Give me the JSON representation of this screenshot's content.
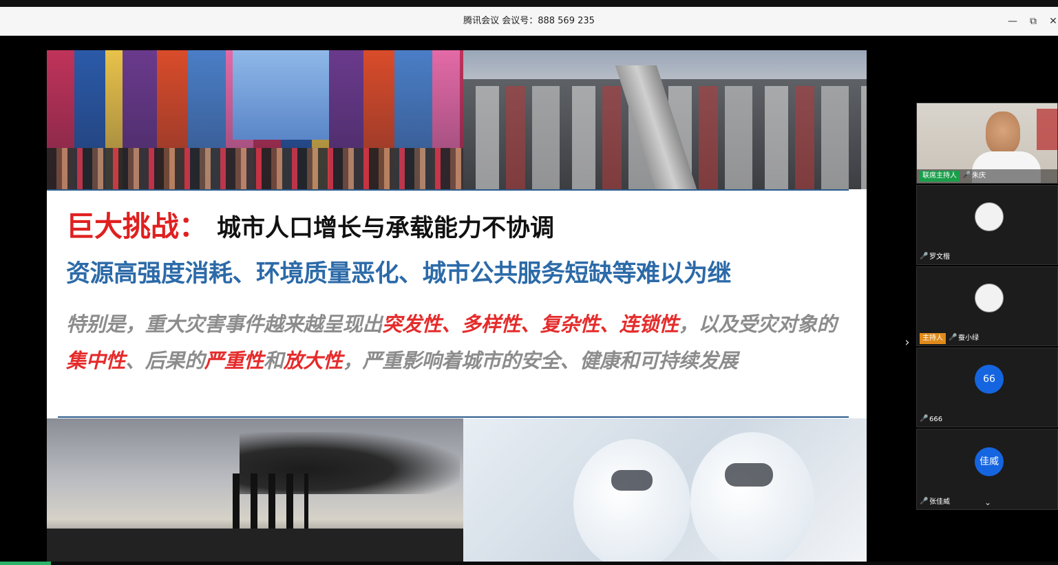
{
  "window": {
    "title": "腾讯会议 会议号：888 569 235",
    "minimize_icon": "—",
    "restore_icon": "⧉",
    "close_icon": "✕"
  },
  "slide": {
    "headline_red": "巨大挑战：",
    "headline_black": "城市人口增长与承载能力不协调",
    "subline": "资源高强度消耗、环境质量恶化、城市公共服务短缺等难以为继",
    "para_parts": {
      "p1": "特别是，重大灾害事件越来越呈现出",
      "h1": "突发性",
      "s1": "、",
      "h2": "多样性",
      "s2": "、",
      "h3": "复杂性",
      "s3": "、",
      "h4": "连锁性",
      "p2": "，以及受灾对象的",
      "h5": "集中性",
      "p3": "、后果的",
      "h6": "严重性",
      "p4": "和",
      "h7": "放大性",
      "p5": "，严重影响着城市的安全、健康和可持续发展"
    }
  },
  "panel": {
    "expand_icon": "›",
    "collapse_icon": "⌄",
    "participants": [
      {
        "role": "联席主持人",
        "name": "朱庆",
        "mic_icon": "🎤"
      },
      {
        "role": "",
        "name": "罗文楷",
        "avatar_text": "",
        "mic_icon": "🎤"
      },
      {
        "role": "主持人",
        "name": "蚕小绿",
        "avatar_text": "",
        "mic_icon": "🎤"
      },
      {
        "role": "",
        "name": "666",
        "avatar_text": "66",
        "mic_icon": "🎤"
      },
      {
        "role": "",
        "name": "张佳威",
        "avatar_text": "佳威",
        "mic_icon": "🎤"
      }
    ]
  },
  "colors": {
    "accent_red": "#e02020",
    "accent_blue": "#2c6aa8",
    "avatar_blue": "#1565e0",
    "cohost_green": "#1a9e4a",
    "host_orange": "#e08a1a"
  }
}
